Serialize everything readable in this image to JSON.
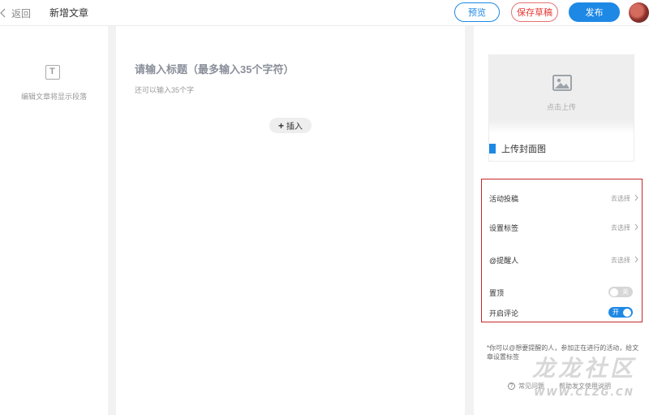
{
  "header": {
    "back_label": "返回",
    "page_title": "新增文章",
    "preview_label": "预览",
    "save_draft_label": "保存草稿",
    "publish_label": "发布"
  },
  "outline": {
    "tip": "编辑文章将显示段落"
  },
  "editor": {
    "title_placeholder": "请输入标题（最多输入35个字符）",
    "title_remaining": "还可以输入35个字",
    "insert_label": "插入"
  },
  "cover": {
    "upload_label": "点击上传",
    "title": "上传封面图"
  },
  "settings": {
    "activity": {
      "label": "活动投稿",
      "action": "去选择"
    },
    "tags": {
      "label": "设置标签",
      "action": "去选择"
    },
    "mention": {
      "label": "@提醒人",
      "action": "去选择"
    },
    "pin": {
      "label": "置顶",
      "state_text": "关",
      "on": false
    },
    "comments": {
      "label": "开启评论",
      "state_text": "开",
      "on": true
    }
  },
  "hint": "*你可以@想要提醒的人，参加正在进行的活动，给文章设置标签",
  "help": {
    "link1": "常见问题",
    "link2": "帮助发文使用说明"
  },
  "watermark": {
    "text": "龙龙社区",
    "url": "WWW.CLZG.CN"
  },
  "colors": {
    "accent": "#1e88e5",
    "draft": "#e53935",
    "settings_border": "#c62828"
  }
}
